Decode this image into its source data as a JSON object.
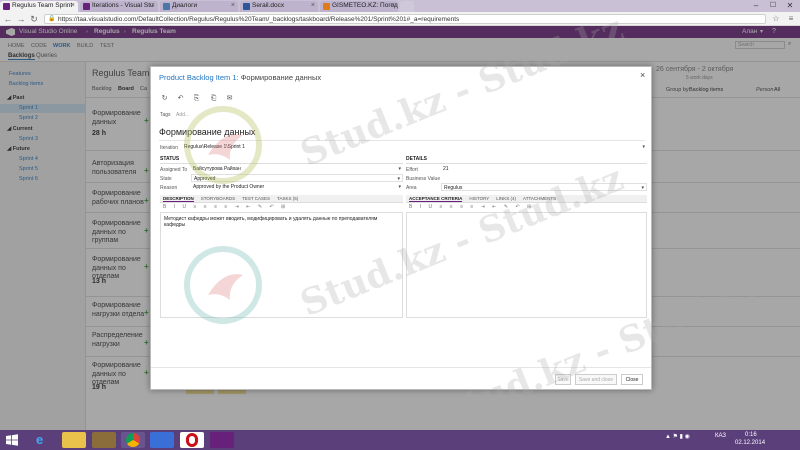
{
  "browser": {
    "tabs": [
      {
        "label": "Regulus Team Sprint",
        "icon_color": "#68217a",
        "active": true
      },
      {
        "label": "Iterations - Visual Stu",
        "icon_color": "#68217a",
        "active": false
      },
      {
        "label": "Диалоги",
        "icon_color": "#4a76a8",
        "active": false
      },
      {
        "label": "Serail.docx",
        "icon_color": "#2b579a",
        "active": false
      },
      {
        "label": "GISMETEO.KZ: Погод",
        "icon_color": "#e07b1a",
        "active": false
      }
    ],
    "close_glyph": "×",
    "url": "https://taa.visualstudio.com/DefaultCollection/Regulus/Regulus%20Team/_backlogs/taskboard/Release%201/Sprint%201#_a=requirements",
    "win_min": "–",
    "win_max": "☐",
    "win_close": "✕",
    "back": "←",
    "forward": "→",
    "reload": "↻"
  },
  "vso": {
    "brand": "Visual Studio Online",
    "project": "Regulus",
    "team": "Regulus Team",
    "user": "Алан",
    "search_placeholder": "Search",
    "hub_tabs": [
      "HOME",
      "CODE",
      "WORK",
      "BUILD",
      "TEST"
    ],
    "sub_tabs": [
      "Backlogs",
      "Queries"
    ]
  },
  "sidebar": {
    "links": [
      "Features",
      "Backlog items"
    ],
    "groups": [
      {
        "label": "Past",
        "items": [
          "Sprint 1",
          "Sprint 2"
        ]
      },
      {
        "label": "Current",
        "items": [
          "Sprint 3"
        ]
      },
      {
        "label": "Future",
        "items": [
          "Sprint 4",
          "Sprint 5",
          "Sprint 6"
        ]
      }
    ]
  },
  "board": {
    "title": "Regulus Team Sprint",
    "views": [
      "Backlog",
      "Board",
      "Ca"
    ],
    "date_range": "26 сентября - 2 октября",
    "work_days": "5 work days",
    "group_by_label": "Group by",
    "group_by_value": "Backlog items",
    "person_label": "Person",
    "person_value": "All",
    "rows": [
      {
        "lines": [
          "Формирование",
          "данных"
        ],
        "hours": "28 h"
      },
      {
        "lines": [
          "Авторизация",
          "пользователя"
        ],
        "hours": ""
      },
      {
        "lines": [
          "Формирование",
          "рабочих планов"
        ],
        "hours": ""
      },
      {
        "lines": [
          "Формирование",
          "данных по группам"
        ],
        "hours": ""
      },
      {
        "lines": [
          "Формирование",
          "данных по отделам"
        ],
        "hours": "13 h"
      },
      {
        "lines": [
          "Формирование",
          "нагрузки отдела"
        ],
        "hours": ""
      },
      {
        "lines": [
          "Распределение",
          "нагрузки"
        ],
        "hours": ""
      },
      {
        "lines": [
          "Формирование",
          "данных по отделам"
        ],
        "hours": "19 h"
      }
    ],
    "plus": "+"
  },
  "dialog": {
    "title_prefix": "Product Backlog Item 1:",
    "title_name": "Формирование данных",
    "close": "×",
    "toolbar_icons": [
      "refresh-icon",
      "undo-icon",
      "copy-icon",
      "attach-icon",
      "mail-icon"
    ],
    "tags_label": "Tags",
    "tags_add": "Add...",
    "work_item_title": "Формирование данных",
    "iteration_label": "Iteration",
    "iteration_value": "Regulus\\Release 1\\Sprint 1",
    "status": {
      "heading": "STATUS",
      "assigned_to_label": "Assigned To",
      "assigned_to": "Байсутурова Райхан",
      "state_label": "State",
      "state": "Approved",
      "reason_label": "Reason",
      "reason": "Approved by the Product Owner"
    },
    "details": {
      "heading": "DETAILS",
      "effort_label": "Effort",
      "effort": "21",
      "business_value_label": "Business Value",
      "business_value": "",
      "area_label": "Area",
      "area": "Regulus"
    },
    "left_tabs": [
      "DESCRIPTION",
      "STORYBOARDS",
      "TEST CASES",
      "TASKS (5)"
    ],
    "right_tabs": [
      "ACCEPTANCE CRITERIA",
      "HISTORY",
      "LINKS (4)",
      "ATTACHMENTS"
    ],
    "description_text": "Методист кафедры может вводить, модифицировать и удалять данные по преподавателям кафедры",
    "buttons": {
      "save": "Save",
      "save_close": "Save and close",
      "close": "Close"
    }
  },
  "watermark": "Stud.kz - Stud.kz",
  "taskbar": {
    "lang": "КАЗ",
    "time": "0:16",
    "date": "02.12.2014"
  },
  "colors": {
    "vso_purple": "#68217a",
    "link_blue": "#1e73be",
    "selected_row": "#cde3f5",
    "taskbar": "#5a3f7a"
  }
}
